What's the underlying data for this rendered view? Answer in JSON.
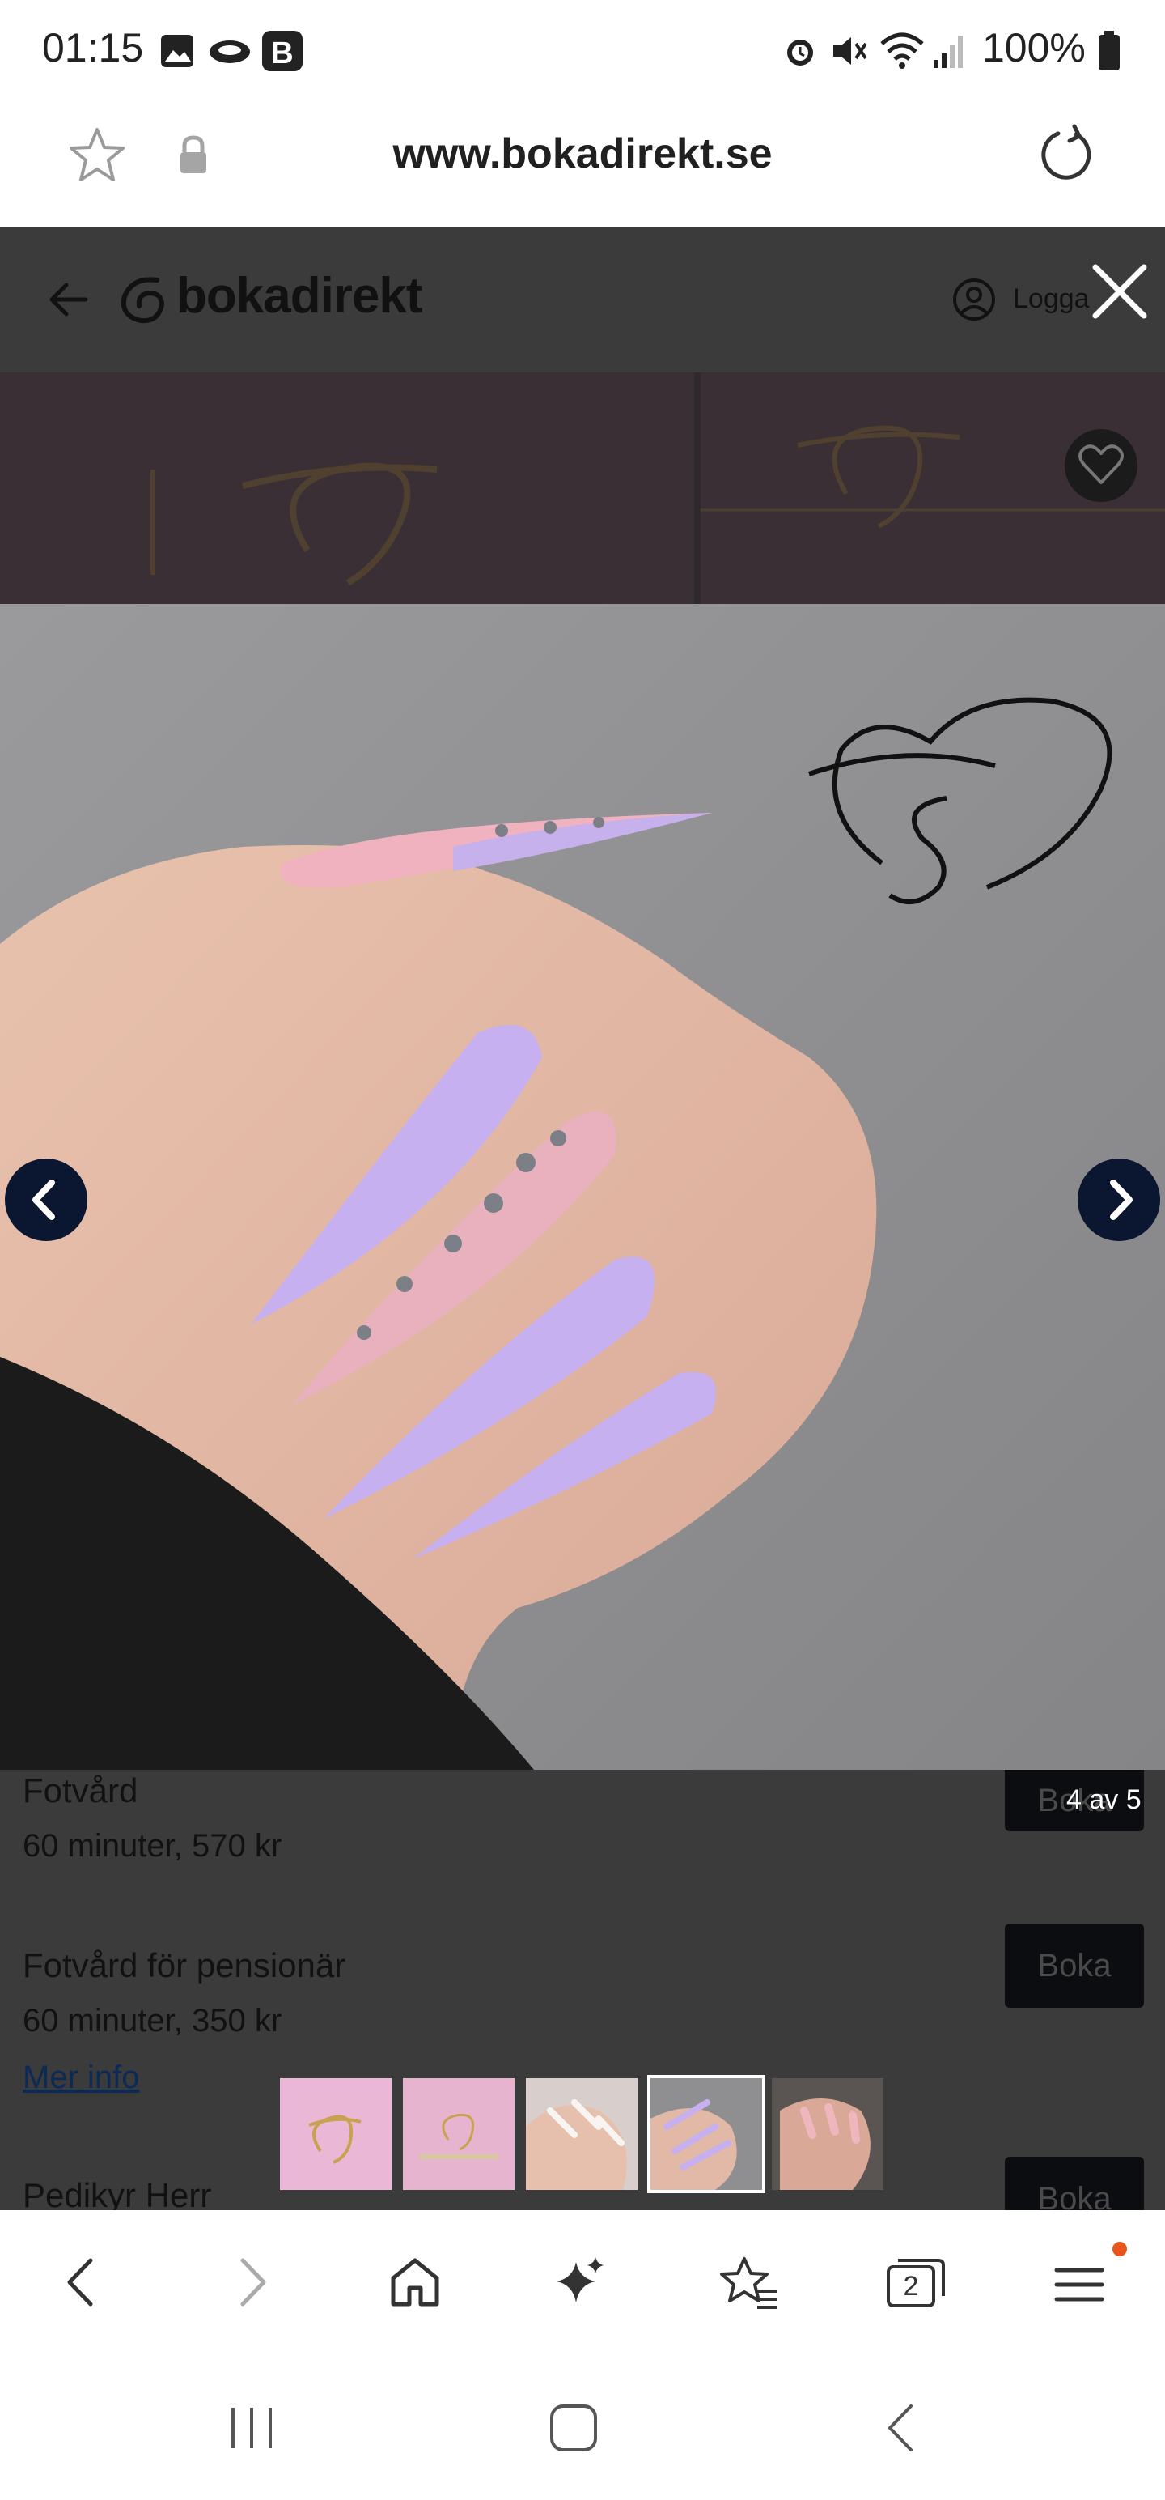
{
  "status_bar": {
    "time": "01:15",
    "battery": "100%"
  },
  "browser": {
    "url": "www.bokadirekt.se"
  },
  "site": {
    "logo_text": "bokadirekt",
    "login_label": "Logga"
  },
  "gallery": {
    "counter": "4 av 5",
    "current_index": 4,
    "total": 5,
    "thumbnails": [
      "ts-logo-pink",
      "ts-logo-banner",
      "nails-white",
      "nails-lilac",
      "nails-pink"
    ]
  },
  "services": [
    {
      "name": "Fotvård",
      "meta": "60 minuter, 570 kr",
      "button": "Boka"
    },
    {
      "name": "Fotvård för pensionär",
      "meta": "60 minuter, 350 kr",
      "button": "Boka",
      "link": "Mer info"
    },
    {
      "name": "Pedikyr Herr",
      "button": "Boka"
    }
  ],
  "toolbar": {
    "tabs_count": "2"
  },
  "colors": {
    "overlay": "#3b3b3b",
    "arrow_bg": "#0b1731",
    "boka_bg": "#0c0d10",
    "thumb_pink": "#eab8d6",
    "notification_dot": "#e8561e"
  },
  "icons": [
    "image-icon",
    "cloud-icon",
    "b-app-icon",
    "alarm-icon",
    "mute-icon",
    "wifi-icon",
    "signal-icon",
    "battery-icon",
    "star-icon",
    "lock-icon",
    "reload-icon",
    "back-arrow-icon",
    "user-icon",
    "close-icon",
    "heart-icon",
    "chevron-left-icon",
    "chevron-right-icon",
    "home-icon",
    "sparkle-icon",
    "bookmarks-icon",
    "tabs-icon",
    "menu-icon"
  ]
}
